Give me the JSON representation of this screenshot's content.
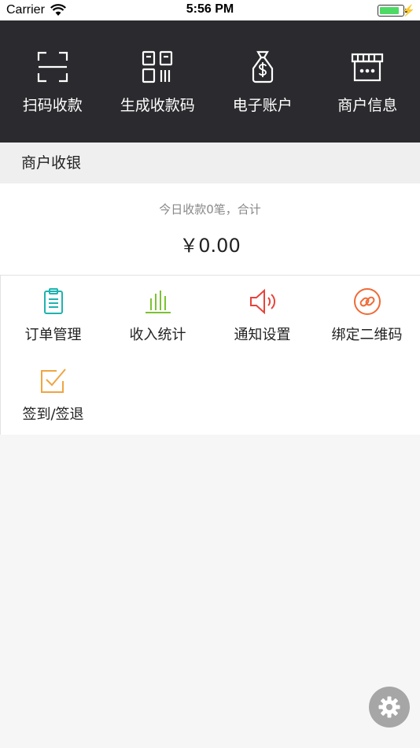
{
  "status_bar": {
    "carrier": "Carrier",
    "time": "5:56 PM"
  },
  "top_menu": [
    {
      "label": "扫码收款",
      "icon": "scan-icon"
    },
    {
      "label": "生成收款码",
      "icon": "qr-code-icon"
    },
    {
      "label": "电子账户",
      "icon": "money-bag-icon"
    },
    {
      "label": "商户信息",
      "icon": "shop-icon"
    }
  ],
  "section": {
    "title": "商户收银"
  },
  "summary": {
    "text": "今日收款0笔，合计",
    "amount": "￥0.00"
  },
  "grid": [
    {
      "label": "订单管理",
      "icon": "clipboard-icon",
      "color": "#1fb3b0"
    },
    {
      "label": "收入统计",
      "icon": "bar-chart-icon",
      "color": "#7cc233"
    },
    {
      "label": "通知设置",
      "icon": "speaker-icon",
      "color": "#e8433b"
    },
    {
      "label": "绑定二维码",
      "icon": "link-icon",
      "color": "#f06a35"
    },
    {
      "label": "签到/签退",
      "icon": "checkbox-icon",
      "color": "#f0a540"
    }
  ],
  "colors": {
    "top_menu_bg": "#2b2b2f",
    "fab_bg": "#a6a6a6"
  }
}
